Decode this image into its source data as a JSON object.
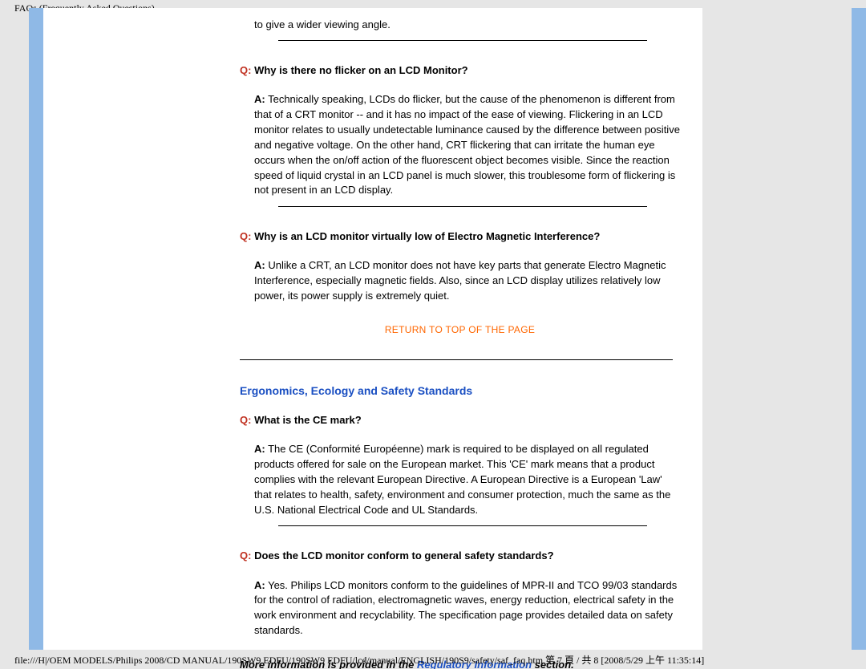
{
  "header": {
    "title": "FAQs (Frequently Asked Questions)"
  },
  "intro_partial": "to give a wider viewing angle.",
  "faqs": [
    {
      "q_label": "Q:",
      "q_text": " Why is there no flicker on an LCD Monitor?",
      "a_label": "A:",
      "a_text": " Technically speaking, LCDs do flicker, but the cause of the phenomenon is different from that of a CRT monitor -- and it has no impact of the ease of viewing. Flickering in an LCD monitor relates to usually undetectable luminance caused by the difference between positive and negative voltage. On the other hand, CRT flickering that can irritate the human eye occurs when the on/off action of the fluorescent object becomes visible. Since the reaction speed of liquid crystal in an LCD panel is much slower, this troublesome form of flickering is not present in an LCD display."
    },
    {
      "q_label": "Q:",
      "q_text": " Why is an LCD monitor virtually low of Electro Magnetic Interference?",
      "a_label": "A:",
      "a_text": " Unlike a CRT, an LCD monitor does not have key parts that generate Electro Magnetic Interference, especially magnetic fields. Also, since an LCD display utilizes relatively low power, its power supply is extremely quiet."
    }
  ],
  "return_link": "RETURN TO TOP OF THE PAGE",
  "section_heading": "Ergonomics, Ecology and Safety Standards",
  "faqs2": [
    {
      "q_label": "Q:",
      "q_text": " What is the CE mark?",
      "a_label": "A:",
      "a_text": " The CE (Conformité Européenne) mark is required to be displayed on all regulated products offered for sale on the European market. This 'CE' mark means that a product complies with the relevant European Directive. A European Directive is a European 'Law' that relates to health, safety, environment and consumer protection, much the same as the U.S. National Electrical Code and UL Standards."
    },
    {
      "q_label": "Q:",
      "q_text": " Does the LCD monitor conform to general safety standards?",
      "a_label": "A:",
      "a_text": " Yes. Philips LCD monitors conform to the guidelines of MPR-II and TCO 99/03 standards for the control of radiation, electromagnetic waves, energy reduction, electrical safety in the work environment and recyclability. The specification page provides detailed data on safety standards."
    }
  ],
  "more_info": {
    "prefix": "More information is provided in the ",
    "link_text": "Regulatory Information",
    "suffix": " section."
  },
  "footer": {
    "path": "file:///H|/OEM MODELS/Philips 2008/CD MANUAL/190SW9 EDFU/190SW9 EDFU/lcd/manual/ENGLISH/190S9/safety/saf_faq.htm 第 7 頁 / 共 8  [2008/5/29 上午 11:35:14]"
  }
}
